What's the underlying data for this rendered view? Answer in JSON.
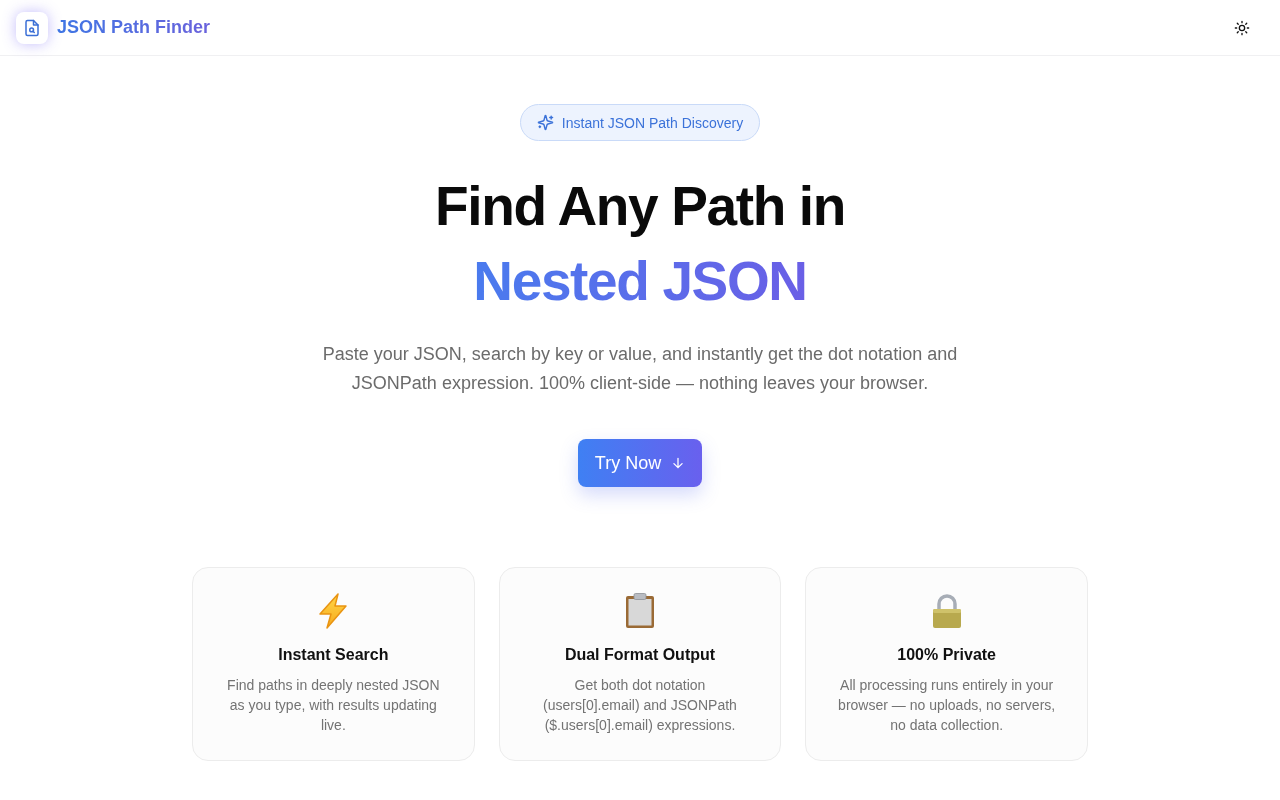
{
  "header": {
    "title": "JSON Path Finder"
  },
  "hero": {
    "badge": "Instant JSON Path Discovery",
    "headline": "Find Any Path in",
    "headline_accent": "Nested JSON",
    "description": "Paste your JSON, search by key or value, and instantly get the dot notation and JSONPath expression. 100% client-side — nothing leaves your browser.",
    "cta": "Try Now"
  },
  "features": [
    {
      "title": "Instant Search",
      "description": "Find paths in deeply nested JSON as you type, with results updating live."
    },
    {
      "title": "Dual Format Output",
      "description": "Get both dot notation (users[0].email) and JSONPath ($.users[0].email) expressions."
    },
    {
      "title": "100% Private",
      "description": "All processing runs entirely in your browser — no uploads, no servers, no data collection."
    }
  ]
}
